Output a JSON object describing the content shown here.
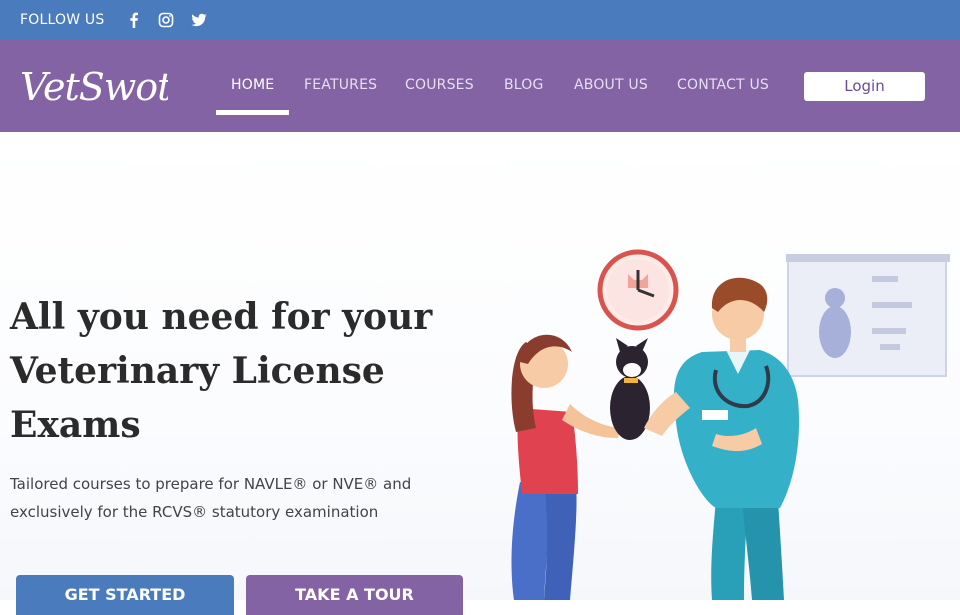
{
  "topbar": {
    "follow_label": "FOLLOW US",
    "social_icons": [
      "facebook-icon",
      "instagram-icon",
      "twitter-icon"
    ],
    "background": "#4a7bbd"
  },
  "brand": {
    "logo_text": "VetSwot",
    "nav_background": "#8363a3"
  },
  "nav": {
    "items": [
      {
        "label": "HOME",
        "active": true
      },
      {
        "label": "FEATURES"
      },
      {
        "label": "COURSES"
      },
      {
        "label": "BLOG"
      },
      {
        "label": "ABOUT US"
      },
      {
        "label": "CONTACT US"
      }
    ],
    "login_label": "Login"
  },
  "hero": {
    "headline": "All you need for your Veterinary License Exams",
    "subtext": "Tailored courses to prepare for NAVLE® or NVE® and exclusively for the RCVS® statutory examination",
    "buttons": {
      "get_started": "GET STARTED",
      "take_tour": "TAKE A TOUR"
    }
  }
}
